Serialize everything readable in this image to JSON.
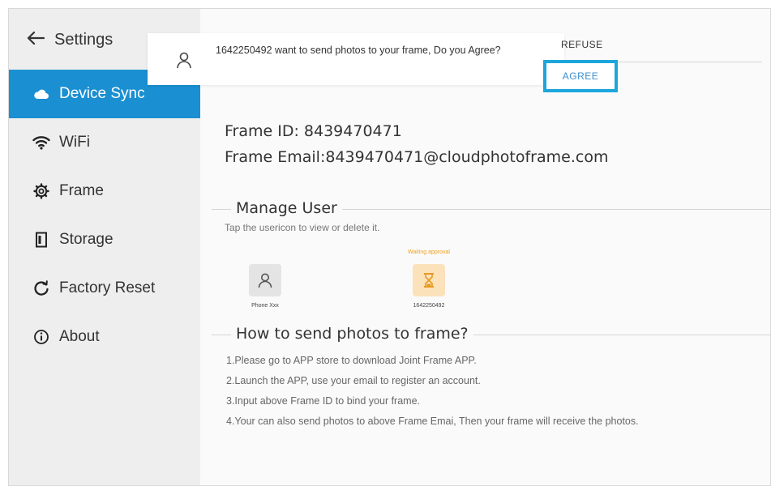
{
  "header": {
    "back_label": "Settings"
  },
  "sidebar": {
    "items": [
      {
        "label": "Device Sync",
        "icon": "cloud-icon",
        "active": true
      },
      {
        "label": "WiFi",
        "icon": "wifi-icon",
        "active": false
      },
      {
        "label": "Frame",
        "icon": "gear-icon",
        "active": false
      },
      {
        "label": "Storage",
        "icon": "storage-icon",
        "active": false
      },
      {
        "label": "Factory Reset",
        "icon": "reset-icon",
        "active": false
      },
      {
        "label": "About",
        "icon": "info-icon",
        "active": false
      }
    ]
  },
  "notification": {
    "message": "1642250492 want to send photos to your frame, Do you Agree?",
    "refuse_label": "REFUSE",
    "agree_label": "AGREE"
  },
  "frame_info": {
    "id_line": "Frame ID: 8439470471",
    "email_line": "Frame Email:8439470471@cloudphotoframe.com"
  },
  "manage_user": {
    "title": "Manage User",
    "hint": "Tap the usericon to view or delete it.",
    "users": [
      {
        "name": "Phone Xxx",
        "status": ""
      },
      {
        "name": "1642250492",
        "status": "Waiting approval"
      }
    ]
  },
  "howto": {
    "title": "How to send photos to frame?",
    "steps": [
      "1.Please go to APP store to download Joint Frame APP.",
      "2.Launch the APP, use your email to register an account.",
      "3.Input above Frame ID to bind your frame.",
      "4.Your can also send photos to above Frame Emai, Then your frame will receive the photos."
    ]
  },
  "colors": {
    "accent": "#1a8fd1",
    "highlight": "#1ca6db",
    "pending": "#f0a020",
    "sidebar_bg": "#eeeeee"
  }
}
